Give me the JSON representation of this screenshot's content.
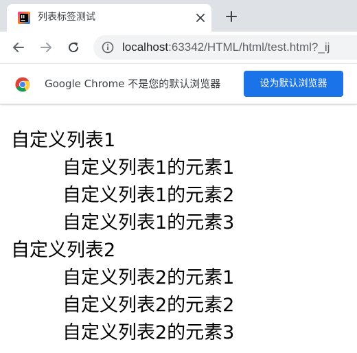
{
  "tab": {
    "title": "列表标签测试",
    "favicon": "jetbrains-logo-icon",
    "close_icon": "close-icon"
  },
  "toolbar": {
    "back_icon": "arrow-left-icon",
    "forward_icon": "arrow-right-icon",
    "reload_icon": "reload-icon",
    "info_icon": "info-icon",
    "url_host": "localhost",
    "url_rest": ":63342/HTML/html/test.html?_ij"
  },
  "infobar": {
    "message": "Google Chrome 不是您的默认浏览器",
    "button_label": "设为默认浏览器",
    "button_color": "#1a73e8"
  },
  "page": {
    "list": [
      {
        "term": "自定义列表1",
        "items": [
          "自定义列表1的元素1",
          "自定义列表1的元素2",
          "自定义列表1的元素3"
        ]
      },
      {
        "term": "自定义列表2",
        "items": [
          "自定义列表2的元素1",
          "自定义列表2的元素2",
          "自定义列表2的元素3"
        ]
      }
    ]
  }
}
